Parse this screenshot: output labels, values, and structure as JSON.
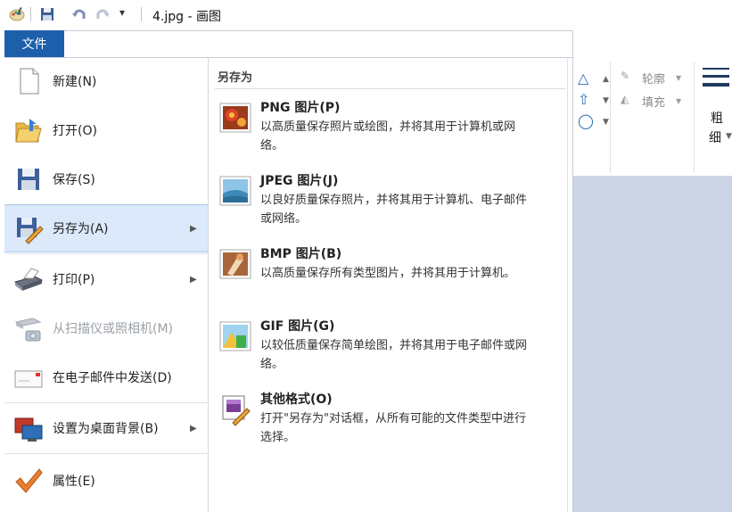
{
  "titlebar": {
    "title": "4.jpg - 画图",
    "quick_access_arrow": "▾"
  },
  "file_tab": {
    "label": "文件"
  },
  "menu": {
    "items": [
      {
        "name": "new",
        "label": "新建(N)",
        "icon": "new-document-icon"
      },
      {
        "name": "open",
        "label": "打开(O)",
        "icon": "open-folder-icon"
      },
      {
        "name": "save",
        "label": "保存(S)",
        "icon": "save-floppy-icon"
      },
      {
        "name": "save-as",
        "label": "另存为(A)",
        "icon": "save-as-icon",
        "submenu": true,
        "active": true
      },
      {
        "name": "print",
        "label": "打印(P)",
        "icon": "printer-icon",
        "submenu": true
      },
      {
        "name": "scan",
        "label": "从扫描仪或照相机(M)",
        "icon": "scanner-camera-icon",
        "disabled": true
      },
      {
        "name": "email",
        "label": "在电子邮件中发送(D)",
        "icon": "email-envelope-icon"
      },
      {
        "name": "desktop-bg",
        "label": "设置为桌面背景(B)",
        "icon": "desktop-background-icon",
        "submenu": true
      },
      {
        "name": "properties",
        "label": "属性(E)",
        "icon": "checkmark-icon"
      }
    ],
    "submenu_arrow": "▶"
  },
  "save_as_submenu": {
    "header": "另存为",
    "items": [
      {
        "title": "PNG 图片(P)",
        "desc": "以高质量保存照片或绘图，并将其用于计算机或网络。",
        "icon": "png-image-icon"
      },
      {
        "title": "JPEG 图片(J)",
        "desc": "以良好质量保存照片，并将其用于计算机、电子邮件或网络。",
        "icon": "jpeg-image-icon"
      },
      {
        "title": "BMP 图片(B)",
        "desc": "以高质量保存所有类型图片，并将其用于计算机。",
        "icon": "bmp-image-icon"
      },
      {
        "title": "GIF 图片(G)",
        "desc": "以较低质量保存简单绘图，并将其用于电子邮件或网络。",
        "icon": "gif-image-icon"
      },
      {
        "title": "其他格式(O)",
        "desc": "打开\"另存为\"对话框，从所有可能的文件类型中进行选择。",
        "icon": "other-formats-icon"
      }
    ]
  },
  "ribbon": {
    "outline_label": "轮廓",
    "fill_label": "填充",
    "thickness_label_1": "粗",
    "thickness_label_2": "细",
    "dropdown_arrow": "▾"
  },
  "colors": {
    "file_tab_bg": "#1e5fab",
    "active_item_bg": "#dbe9fa",
    "canvas_bg": "#cbd5e6"
  }
}
